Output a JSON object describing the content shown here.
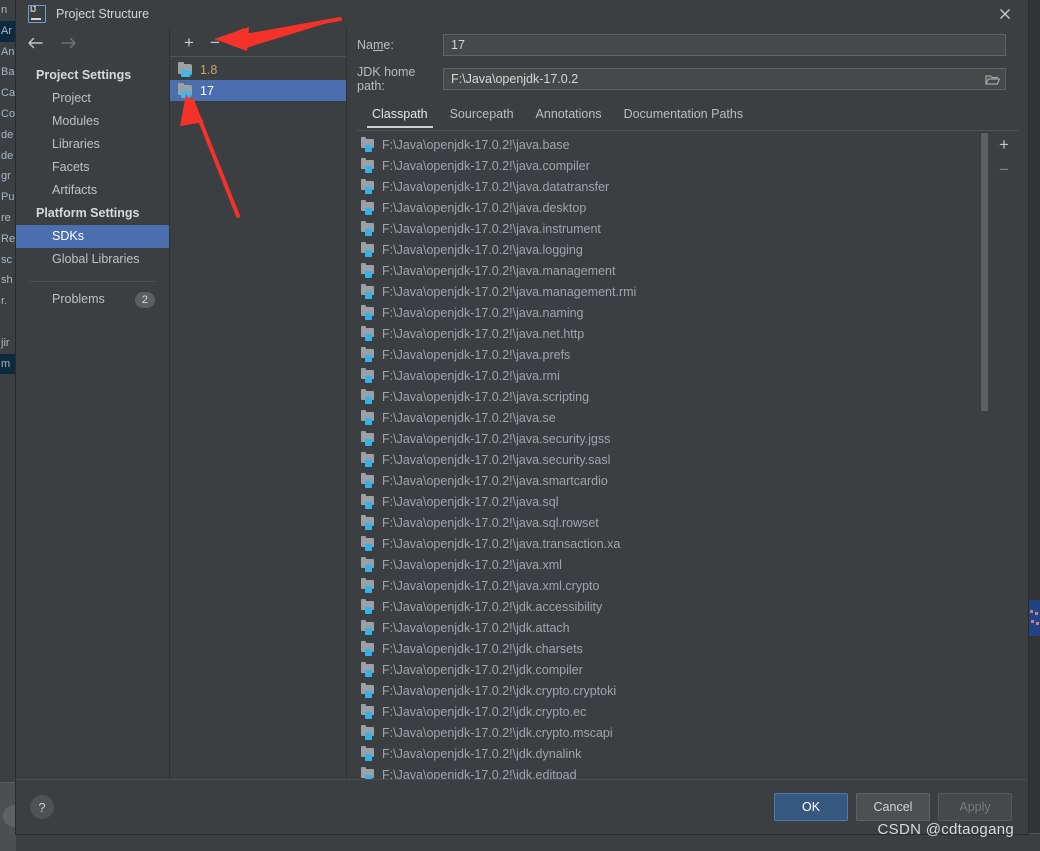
{
  "window": {
    "title": "Project Structure",
    "app_icon": "intellij-logo-icon",
    "close_label": "✕"
  },
  "navigation": {
    "back_icon": "arrow-left-icon",
    "forward_icon": "arrow-right-icon",
    "groups": [
      {
        "title": "Project Settings",
        "items": [
          {
            "label": "Project",
            "selected": false
          },
          {
            "label": "Modules",
            "selected": false
          },
          {
            "label": "Libraries",
            "selected": false
          },
          {
            "label": "Facets",
            "selected": false
          },
          {
            "label": "Artifacts",
            "selected": false
          }
        ]
      },
      {
        "title": "Platform Settings",
        "items": [
          {
            "label": "SDKs",
            "selected": true
          },
          {
            "label": "Global Libraries",
            "selected": false
          }
        ]
      }
    ],
    "problems": {
      "label": "Problems",
      "count": "2"
    }
  },
  "sdk_panel": {
    "toolbar": {
      "add_label": "+",
      "add_name": "add-sdk-button",
      "remove_label": "−",
      "remove_name": "remove-sdk-button"
    },
    "items": [
      {
        "label": "1.8",
        "selected": false,
        "warn": true
      },
      {
        "label": "17",
        "selected": true,
        "warn": false
      }
    ]
  },
  "detail": {
    "name_field": {
      "label_pre": "Na",
      "label_underline": "m",
      "label_post": "e:",
      "value": "17"
    },
    "jdk_home_field": {
      "label": "JDK home path:",
      "value": "F:\\Java\\openjdk-17.0.2",
      "browse_icon": "folder-browse-icon"
    },
    "tabs": [
      {
        "label": "Classpath",
        "active": true
      },
      {
        "label": "Sourcepath",
        "active": false
      },
      {
        "label": "Annotations",
        "active": false
      },
      {
        "label": "Documentation Paths",
        "active": false
      }
    ],
    "rail": {
      "add_label": "+",
      "remove_label": "−"
    },
    "classpath_entries": [
      "F:\\Java\\openjdk-17.0.2!\\java.base",
      "F:\\Java\\openjdk-17.0.2!\\java.compiler",
      "F:\\Java\\openjdk-17.0.2!\\java.datatransfer",
      "F:\\Java\\openjdk-17.0.2!\\java.desktop",
      "F:\\Java\\openjdk-17.0.2!\\java.instrument",
      "F:\\Java\\openjdk-17.0.2!\\java.logging",
      "F:\\Java\\openjdk-17.0.2!\\java.management",
      "F:\\Java\\openjdk-17.0.2!\\java.management.rmi",
      "F:\\Java\\openjdk-17.0.2!\\java.naming",
      "F:\\Java\\openjdk-17.0.2!\\java.net.http",
      "F:\\Java\\openjdk-17.0.2!\\java.prefs",
      "F:\\Java\\openjdk-17.0.2!\\java.rmi",
      "F:\\Java\\openjdk-17.0.2!\\java.scripting",
      "F:\\Java\\openjdk-17.0.2!\\java.se",
      "F:\\Java\\openjdk-17.0.2!\\java.security.jgss",
      "F:\\Java\\openjdk-17.0.2!\\java.security.sasl",
      "F:\\Java\\openjdk-17.0.2!\\java.smartcardio",
      "F:\\Java\\openjdk-17.0.2!\\java.sql",
      "F:\\Java\\openjdk-17.0.2!\\java.sql.rowset",
      "F:\\Java\\openjdk-17.0.2!\\java.transaction.xa",
      "F:\\Java\\openjdk-17.0.2!\\java.xml",
      "F:\\Java\\openjdk-17.0.2!\\java.xml.crypto",
      "F:\\Java\\openjdk-17.0.2!\\jdk.accessibility",
      "F:\\Java\\openjdk-17.0.2!\\jdk.attach",
      "F:\\Java\\openjdk-17.0.2!\\jdk.charsets",
      "F:\\Java\\openjdk-17.0.2!\\jdk.compiler",
      "F:\\Java\\openjdk-17.0.2!\\jdk.crypto.cryptoki",
      "F:\\Java\\openjdk-17.0.2!\\jdk.crypto.ec",
      "F:\\Java\\openjdk-17.0.2!\\jdk.crypto.mscapi",
      "F:\\Java\\openjdk-17.0.2!\\jdk.dynalink",
      "F:\\Java\\openjdk-17.0.2!\\jdk.editpad"
    ]
  },
  "footer": {
    "help_label": "?",
    "ok_label": "OK",
    "cancel_label": "Cancel",
    "apply_label": "Apply",
    "watermark": "CSDN @cdtaogang"
  },
  "background_window": {
    "left_strip_lines": [
      "n",
      "Ar",
      "An",
      "Ba",
      "Ca",
      "Co",
      "de",
      "de",
      "gr",
      "Pu",
      "re",
      "Re",
      "sc",
      "sh",
      "r.",
      "",
      "jir",
      "m"
    ]
  },
  "colors": {
    "accent_selection": "#4b6eaf",
    "primary_button": "#365880",
    "window_background": "#3c3f41",
    "annotation_red": "#f5322a",
    "java_cyan": "#3ab0e8"
  }
}
